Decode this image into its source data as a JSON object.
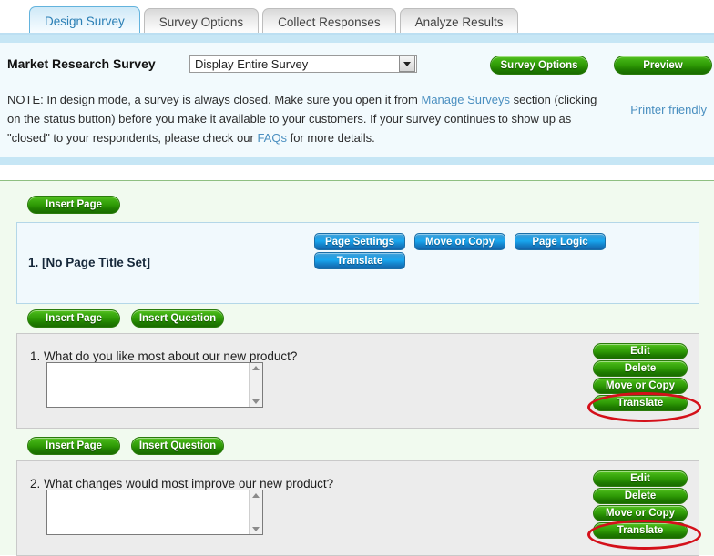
{
  "tabs": [
    {
      "label": "Design Survey",
      "active": true
    },
    {
      "label": "Survey Options",
      "active": false
    },
    {
      "label": "Collect Responses",
      "active": false
    },
    {
      "label": "Analyze Results",
      "active": false
    }
  ],
  "header": {
    "survey_title": "Market Research Survey",
    "display_select_value": "Display Entire Survey",
    "survey_options_button": "Survey Options",
    "preview_button": "Preview",
    "printer_friendly_link": "Printer friendly"
  },
  "note": {
    "part1": "NOTE: In design mode, a survey is always closed. Make sure you open it from ",
    "link1": "Manage Surveys",
    "part2": " section (clicking on the status button) before you make it available to your customers. If your survey continues to show up as \"closed\" to your respondents, please check our ",
    "link2": "FAQs",
    "part3": " for more details."
  },
  "toolbar": {
    "insert_page": "Insert Page",
    "insert_question": "Insert Question"
  },
  "page_block": {
    "title": "1. [No Page Title Set]",
    "buttons": {
      "page_settings": "Page Settings",
      "move_or_copy": "Move or Copy",
      "page_logic": "Page Logic",
      "translate": "Translate"
    }
  },
  "questions": [
    {
      "text": "1. What do you like most about our new product?",
      "buttons": {
        "edit": "Edit",
        "delete": "Delete",
        "move_or_copy": "Move or Copy",
        "translate": "Translate"
      }
    },
    {
      "text": "2. What changes would most improve our new product?",
      "buttons": {
        "edit": "Edit",
        "delete": "Delete",
        "move_or_copy": "Move or Copy",
        "translate": "Translate"
      }
    }
  ],
  "colors": {
    "accent_blue": "#1585cc",
    "accent_green": "#2f9b06",
    "annotation_red": "#d4101a",
    "link_blue": "#4a8fc0",
    "active_tab_text": "#2a7fb5"
  }
}
